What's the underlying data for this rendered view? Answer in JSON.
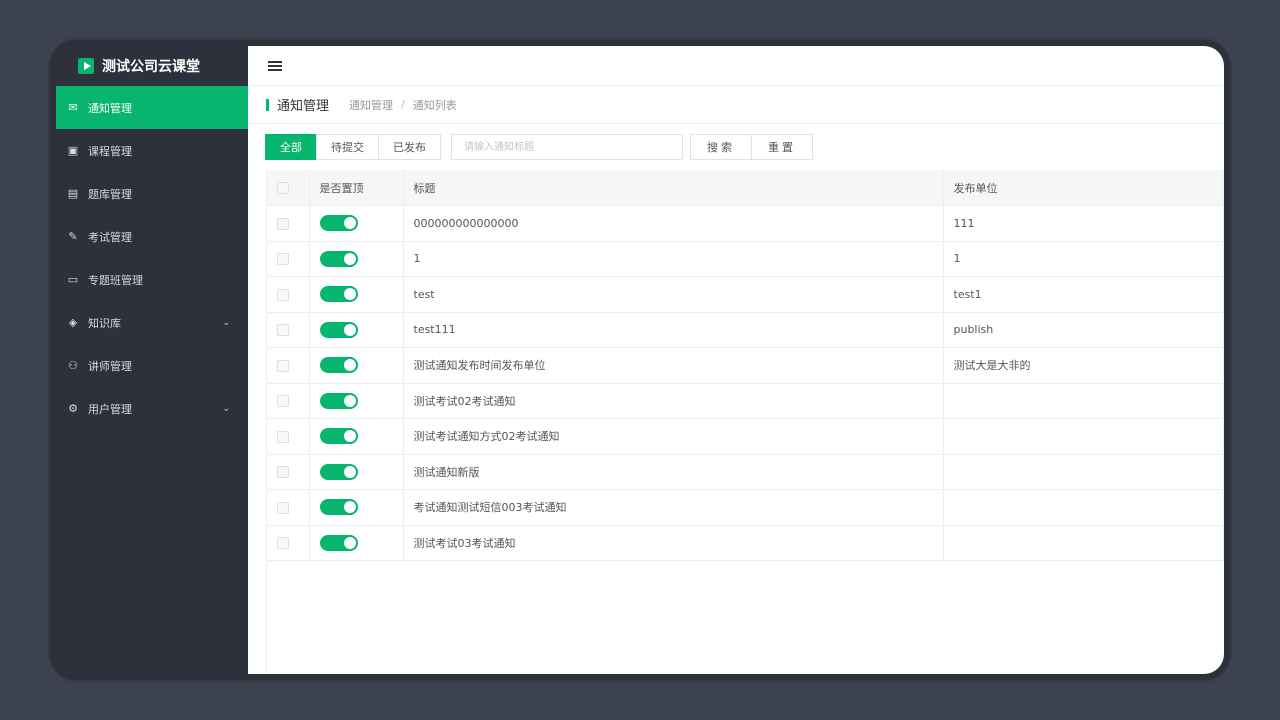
{
  "app": {
    "title": "测试公司云课堂"
  },
  "colors": {
    "accent": "#07b56f",
    "sidebar_bg": "#2d313b"
  },
  "sidebar": {
    "items": [
      {
        "label": "通知管理",
        "icon": "mail-icon",
        "glyph": "✉",
        "active": true,
        "expandable": false
      },
      {
        "label": "课程管理",
        "icon": "course-icon",
        "glyph": "▣",
        "active": false,
        "expandable": false
      },
      {
        "label": "题库管理",
        "icon": "question-bank-icon",
        "glyph": "▤",
        "active": false,
        "expandable": false
      },
      {
        "label": "考试管理",
        "icon": "pen-icon",
        "glyph": "✎",
        "active": false,
        "expandable": false
      },
      {
        "label": "专题班管理",
        "icon": "class-icon",
        "glyph": "▭",
        "active": false,
        "expandable": false
      },
      {
        "label": "知识库",
        "icon": "knowledge-icon",
        "glyph": "◈",
        "active": false,
        "expandable": true
      },
      {
        "label": "讲师管理",
        "icon": "user-icon",
        "glyph": "⚇",
        "active": false,
        "expandable": false
      },
      {
        "label": "用户管理",
        "icon": "settings-icon",
        "glyph": "⚙",
        "active": false,
        "expandable": true
      }
    ]
  },
  "header": {
    "page_title": "通知管理",
    "breadcrumb": [
      "通知管理",
      "通知列表"
    ],
    "breadcrumb_sep": "/"
  },
  "toolbar": {
    "tabs": [
      {
        "label": "全部",
        "active": true
      },
      {
        "label": "待提交",
        "active": false
      },
      {
        "label": "已发布",
        "active": false
      }
    ],
    "search_placeholder": "请输入通知标题",
    "search_button": "搜索",
    "reset_button": "重置"
  },
  "table": {
    "columns": [
      "是否置顶",
      "标题",
      "发布单位"
    ],
    "rows": [
      {
        "pinned": true,
        "title": "000000000000000",
        "unit": "111"
      },
      {
        "pinned": true,
        "title": "1",
        "unit": "1"
      },
      {
        "pinned": true,
        "title": "test",
        "unit": "test1"
      },
      {
        "pinned": true,
        "title": "test111",
        "unit": "publish"
      },
      {
        "pinned": true,
        "title": "测试通知发布时间发布单位",
        "unit": "测试大是大非的"
      },
      {
        "pinned": true,
        "title": "测试考试02考试通知",
        "unit": ""
      },
      {
        "pinned": true,
        "title": "测试考试通知方式02考试通知",
        "unit": ""
      },
      {
        "pinned": true,
        "title": "测试通知新版",
        "unit": ""
      },
      {
        "pinned": true,
        "title": "考试通知测试短信003考试通知",
        "unit": ""
      },
      {
        "pinned": true,
        "title": "测试考试03考试通知",
        "unit": ""
      }
    ]
  }
}
